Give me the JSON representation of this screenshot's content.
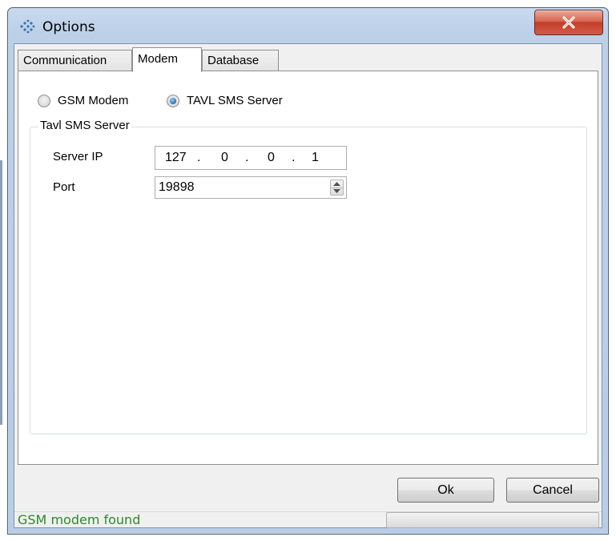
{
  "window": {
    "title": "Options"
  },
  "titlebar": {
    "app_icon": "options-app-icon",
    "close_icon": "close-x-icon"
  },
  "tabs": [
    {
      "label": "Communication",
      "active": false
    },
    {
      "label": "Modem",
      "active": true
    },
    {
      "label": "Database",
      "active": false
    }
  ],
  "modem": {
    "radio_options": [
      {
        "label": "GSM Modem",
        "checked": false
      },
      {
        "label": "TAVL SMS Server",
        "checked": true
      }
    ],
    "group_title": "Tavl SMS Server",
    "server_ip_label": "Server IP",
    "server_ip": [
      "127",
      "0",
      "0",
      "1"
    ],
    "ip_separator": ".",
    "port_label": "Port",
    "port_value": "19898"
  },
  "buttons": {
    "ok": "Ok",
    "cancel": "Cancel"
  },
  "status": {
    "message": "GSM modem found",
    "message_color": "#2d8a2d",
    "progress": 0
  }
}
